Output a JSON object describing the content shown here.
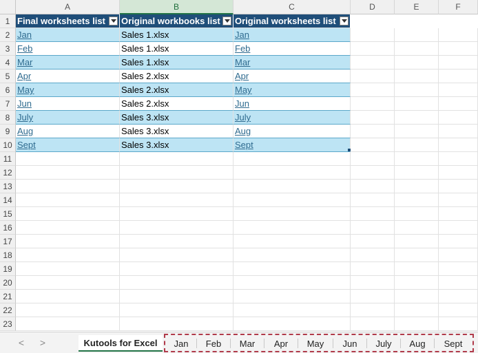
{
  "columns": [
    "A",
    "B",
    "C",
    "D",
    "E",
    "F"
  ],
  "rows": [
    "1",
    "2",
    "3",
    "4",
    "5",
    "6",
    "7",
    "8",
    "9",
    "10",
    "11",
    "12",
    "13",
    "14",
    "15",
    "16",
    "17",
    "18",
    "19",
    "20",
    "21",
    "22",
    "23"
  ],
  "table": {
    "headers": [
      "Final worksheets list",
      "Original workbooks list",
      "Original worksheets list"
    ],
    "data": [
      [
        "Jan",
        "Sales 1.xlsx",
        "Jan"
      ],
      [
        "Feb",
        "Sales 1.xlsx",
        "Feb"
      ],
      [
        "Mar",
        "Sales 1.xlsx",
        "Mar"
      ],
      [
        "Apr",
        "Sales 2.xlsx",
        "Apr"
      ],
      [
        "May",
        "Sales 2.xlsx",
        "May"
      ],
      [
        "Jun",
        "Sales 2.xlsx",
        "Jun"
      ],
      [
        "July",
        "Sales 3.xlsx",
        "July"
      ],
      [
        "Aug",
        "Sales 3.xlsx",
        "Aug"
      ],
      [
        "Sept",
        "Sales 3.xlsx",
        "Sept"
      ]
    ]
  },
  "tabs": {
    "prev": "<",
    "next": ">",
    "active": "Kutools for Excel",
    "sheets": [
      "Jan",
      "Feb",
      "Mar",
      "Apr",
      "May",
      "Jun",
      "July",
      "Aug",
      "Sept"
    ]
  },
  "colors": {
    "header_bg": "#1f4e79",
    "band_bg": "#bde4f4",
    "link": "#2f6b8f",
    "dash_highlight": "#b03a4a"
  }
}
